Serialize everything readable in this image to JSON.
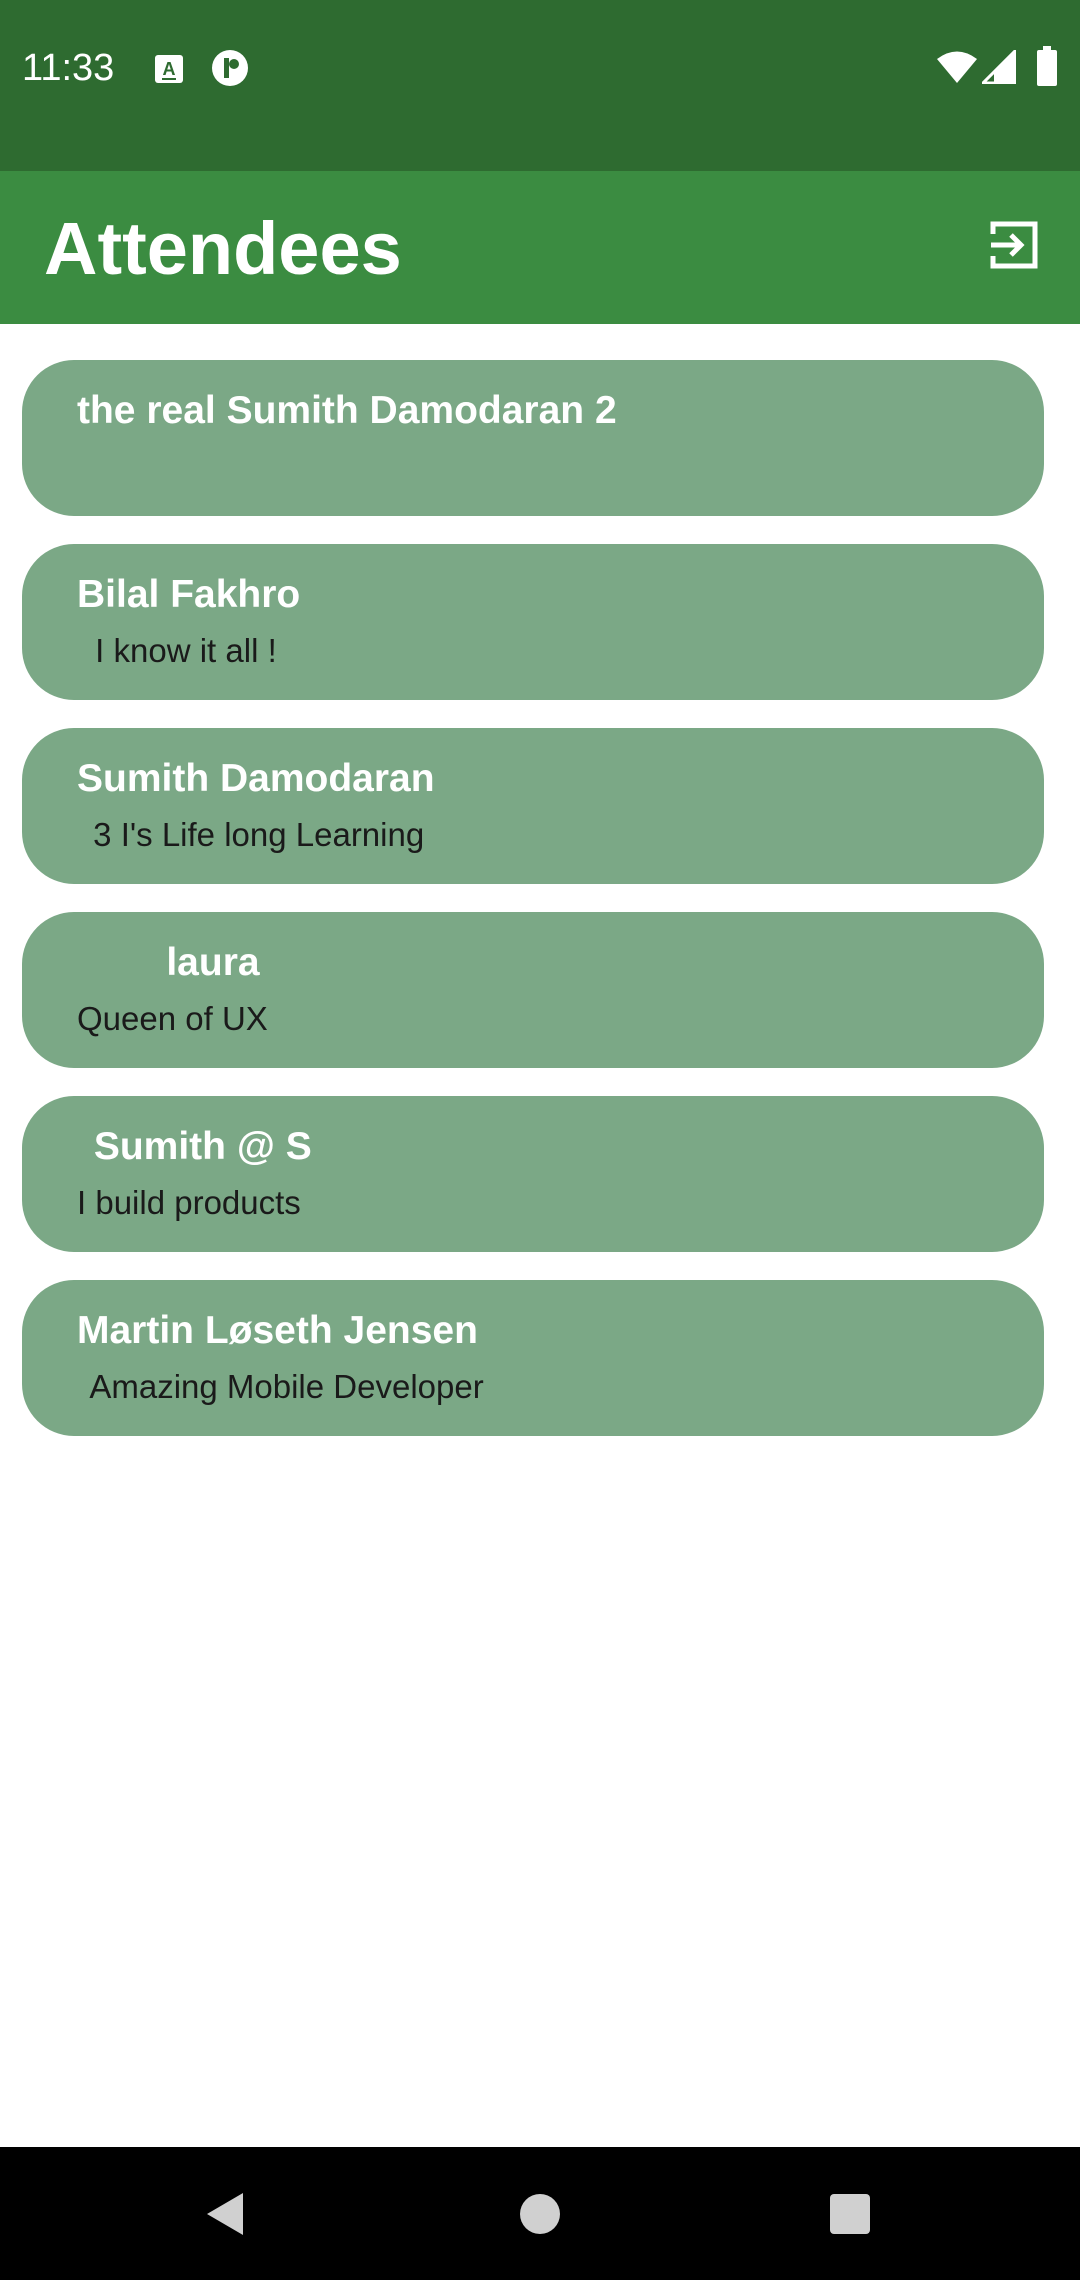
{
  "status_bar": {
    "time": "11:33",
    "left_icons": [
      "keyboard-a-icon",
      "app-notification-icon"
    ],
    "right_icons": [
      "wifi-icon",
      "cell-signal-icon",
      "battery-icon"
    ],
    "color": "#2e6b30"
  },
  "app_bar": {
    "title": "Attendees",
    "action_icon": "logout-icon",
    "color": "#3b8c41"
  },
  "attendees": [
    {
      "name": "the real Sumith Damodaran 2",
      "bio": ""
    },
    {
      "name": "Bilal Fakhro",
      "bio": " I know it all !"
    },
    {
      "name": "Sumith Damodaran",
      "bio": " 3 I's Life long Learning"
    },
    {
      "name": "    laura",
      "bio": "Queen of UX"
    },
    {
      "name": " Sumith @ S",
      "bio": "I build products"
    },
    {
      "name": "Martin Løseth Jensen",
      "bio": " Amazing Mobile Developer"
    }
  ],
  "card_color": "#7ba886",
  "nav_bar": {
    "icons": [
      "back-icon",
      "home-icon",
      "recents-icon"
    ]
  }
}
